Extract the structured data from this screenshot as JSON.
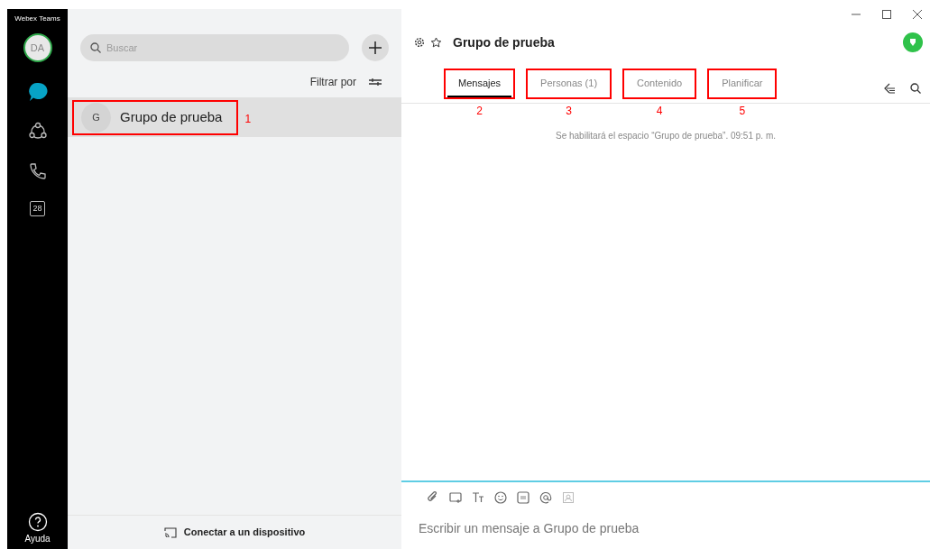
{
  "app_title": "Webex Teams",
  "avatar": {
    "initials": "DA"
  },
  "nav": [
    {
      "kind": "chat",
      "selected": true
    },
    {
      "kind": "teams",
      "selected": false
    },
    {
      "kind": "calls",
      "selected": false
    },
    {
      "kind": "calendar",
      "label": "28",
      "selected": false
    }
  ],
  "help": {
    "label": "Ayuda"
  },
  "search": {
    "placeholder": "Buscar"
  },
  "filter": {
    "label": "Filtrar por"
  },
  "spaces": [
    {
      "initial": "G",
      "name": "Grupo de prueba",
      "selected": true,
      "annotation": "1"
    }
  ],
  "connect": {
    "label": "Conectar a un dispositivo"
  },
  "space": {
    "title": "Grupo de prueba"
  },
  "tabs": [
    {
      "label": "Mensajes",
      "selected": true,
      "annotation": "2"
    },
    {
      "label": "Personas (1)",
      "selected": false,
      "annotation": "3"
    },
    {
      "label": "Contenido",
      "selected": false,
      "annotation": "4"
    },
    {
      "label": "Planificar",
      "selected": false,
      "annotation": "5"
    }
  ],
  "system_message": "Se habilitará el espacio “Grupo de prueba”. 09:51 p. m.",
  "composer": {
    "placeholder": "Escribir un mensaje a Grupo de prueba"
  }
}
